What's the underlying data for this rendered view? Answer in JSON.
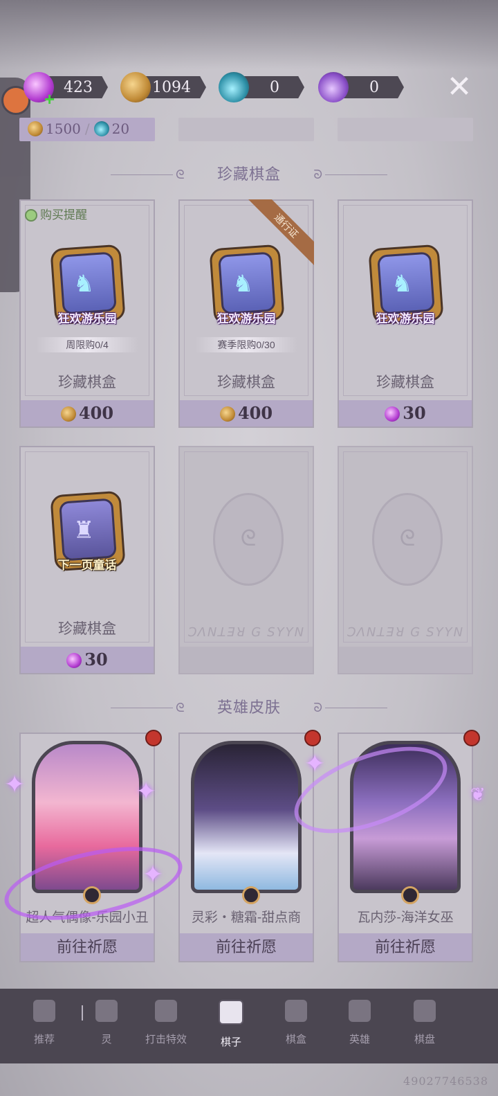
{
  "currency_bar": [
    {
      "icon": "candy-icon",
      "value": "423"
    },
    {
      "icon": "pumpkin-coin-icon",
      "value": "1094"
    },
    {
      "icon": "blue-potion-icon",
      "value": "0"
    },
    {
      "icon": "purple-potion-icon",
      "value": "0"
    }
  ],
  "previous_row": {
    "price_main": "1500",
    "separator": "/",
    "price_alt": "20"
  },
  "sections": {
    "chess_box_title": "珍藏棋盒",
    "hero_skin_title": "英雄皮肤"
  },
  "chess_boxes": [
    {
      "label": "狂欢游乐园",
      "limit": "周限购0/4",
      "name": "珍藏棋盒",
      "price": "400",
      "currency": "pumpkin-coin-icon",
      "reminder": "购买提醒"
    },
    {
      "label": "狂欢游乐园",
      "limit": "赛季限购0/30",
      "name": "珍藏棋盒",
      "price": "400",
      "currency": "pumpkin-coin-icon",
      "ribbon": "通行证"
    },
    {
      "label": "狂欢游乐园",
      "name": "珍藏棋盒",
      "price": "30",
      "currency": "candy-icon"
    },
    {
      "label": "下一页童话",
      "name": "珍藏棋盒",
      "price": "30",
      "currency": "candy-icon"
    }
  ],
  "locked_slots": [
    {
      "runes": "ꓛꓥꓠꓕꓱꓤ ꓖ ꓢꓬꓬꓠ"
    },
    {
      "runes": "ꓛꓥꓠꓕꓱꓤ ꓖ ꓢꓬꓬꓠ"
    }
  ],
  "hero_skins": [
    {
      "name": "超人气偶像-乐园小丑",
      "action": "前往祈愿"
    },
    {
      "name": "灵彩・糖霜-甜点商",
      "action": "前往祈愿"
    },
    {
      "name": "瓦内莎-海洋女巫",
      "action": "前往祈愿"
    }
  ],
  "bottom_nav": [
    {
      "label": "推荐",
      "active": false
    },
    {
      "label": "灵",
      "active": false
    },
    {
      "label": "打击特效",
      "active": false
    },
    {
      "label": "棋子",
      "active": true
    },
    {
      "label": "棋盒",
      "active": false
    },
    {
      "label": "英雄",
      "active": false
    },
    {
      "label": "棋盘",
      "active": false
    }
  ],
  "user_id": "49027746538"
}
